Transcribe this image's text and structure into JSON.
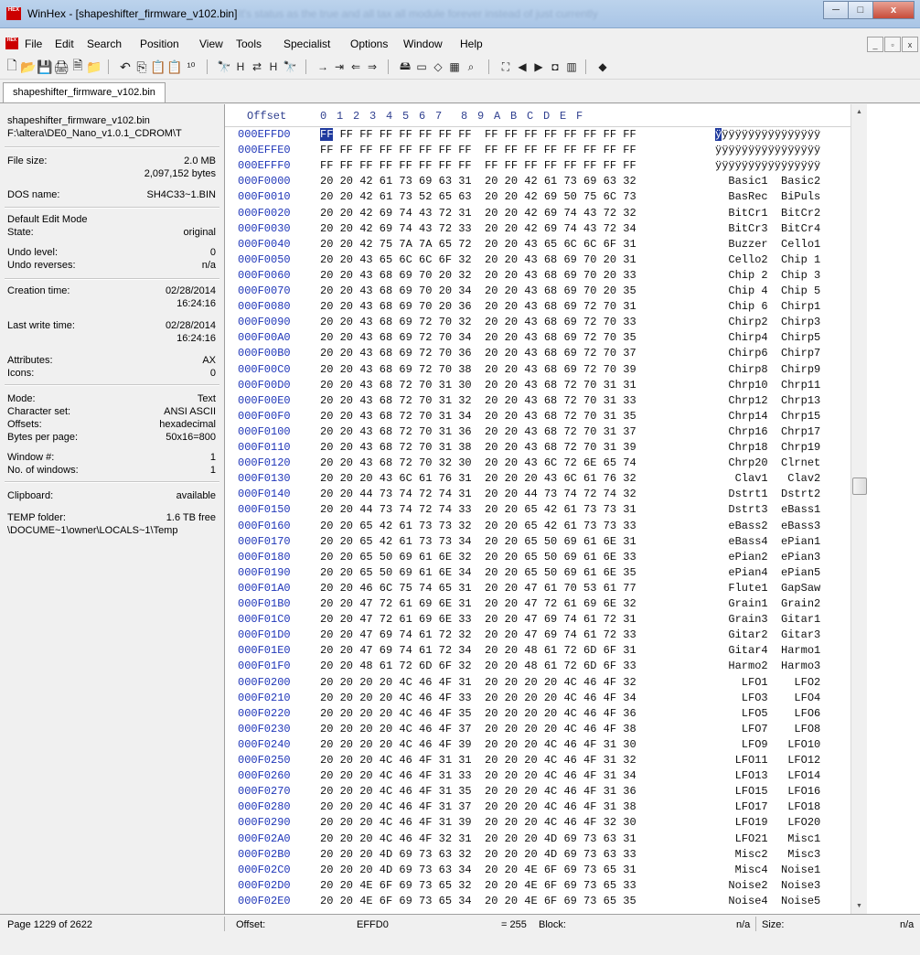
{
  "window": {
    "title": "WinHex - [shapeshifter_firmware_v102.bin]",
    "title_ghost": "It's status as the true and all tax all module forever instead of just currently",
    "minimize": "─",
    "maximize": "□",
    "close": "x"
  },
  "menu": {
    "app_icon": "HEX",
    "items": [
      "File",
      "Edit",
      "Search",
      "Position",
      "View",
      "Tools",
      "Specialist",
      "Options",
      "Window",
      "Help"
    ],
    "mdi_minimize": "_",
    "mdi_restore": "▫",
    "mdi_close": "x"
  },
  "toolbar": {
    "icons": [
      "new-file-icon",
      "open-folder-icon",
      "save-icon",
      "print-icon",
      "properties-icon",
      "open-disk-icon",
      "undo-icon",
      "copy-icon",
      "paste-icon",
      "paste-special-icon",
      "convert-icon",
      "find-text-icon",
      "find-hex-icon",
      "replace-text-icon",
      "replace-hex-icon",
      "find-again-icon",
      "goto-offset-icon",
      "goto-page-icon",
      "back-icon",
      "forward-icon",
      "open-disk-editor-icon",
      "ram-editor-icon",
      "data-interpreter-icon",
      "calculator-icon",
      "search-icon",
      "template-icon",
      "prev-icon",
      "next-icon",
      "camera-icon",
      "table-icon",
      "help-book-icon"
    ],
    "glyphs": [
      "🗋",
      "📂",
      "💾",
      "🖨",
      "🗎",
      "📁",
      "↶",
      "⎘",
      "📋",
      "📋",
      "¹⁰",
      "🔭",
      "H",
      "⇄",
      "H",
      "🔭",
      "→",
      "⇥",
      "⇐",
      "⇒",
      "🖴",
      "▭",
      "◇",
      "▦",
      "⌕",
      "⛶",
      "◀",
      "▶",
      "◘",
      "▥",
      "◆"
    ]
  },
  "tab": {
    "label": "shapeshifter_firmware_v102.bin"
  },
  "info_panel": {
    "file_name": "shapeshifter_firmware_v102.bin",
    "file_path": "F:\\altera\\DE0_Nano_v1.0.1_CDROM\\T",
    "file_size_label": "File size:",
    "file_size_mb": "2.0 MB",
    "file_size_bytes": "2,097,152 bytes",
    "dos_name_label": "DOS name:",
    "dos_name": "SH4C33~1.BIN",
    "edit_mode_label": "Default Edit Mode",
    "state_label": "State:",
    "state": "original",
    "undo_level_label": "Undo level:",
    "undo_level": "0",
    "undo_reverses_label": "Undo reverses:",
    "undo_reverses": "n/a",
    "creation_label": "Creation time:",
    "creation_date": "02/28/2014",
    "creation_time": "16:24:16",
    "lastwrite_label": "Last write time:",
    "lastwrite_date": "02/28/2014",
    "lastwrite_time": "16:24:16",
    "attributes_label": "Attributes:",
    "attributes": "AX",
    "icons_label": "Icons:",
    "icons": "0",
    "mode_label": "Mode:",
    "mode": "Text",
    "charset_label": "Character set:",
    "charset": "ANSI ASCII",
    "offsets_label": "Offsets:",
    "offsets": "hexadecimal",
    "bpp_label": "Bytes per page:",
    "bpp": "50x16=800",
    "window_label": "Window #:",
    "window_num": "1",
    "windows_label": "No. of windows:",
    "windows_count": "1",
    "clipboard_label": "Clipboard:",
    "clipboard": "available",
    "temp_label": "TEMP folder:",
    "temp_free": "1.6 TB free",
    "temp_path": "\\DOCUME~1\\owner\\LOCALS~1\\Temp"
  },
  "hex_view": {
    "offset_header": "Offset",
    "column_headers": [
      "0",
      "1",
      "2",
      "3",
      "4",
      "5",
      "6",
      "7",
      "8",
      "9",
      "A",
      "B",
      "C",
      "D",
      "E",
      "F"
    ],
    "rows": [
      {
        "offset": "000EFFD0",
        "hex": "FF FF FF FF FF FF FF FF  FF FF FF FF FF FF FF FF",
        "text": "ÿÿÿÿÿÿÿÿÿÿÿÿÿÿÿÿ"
      },
      {
        "offset": "000EFFE0",
        "hex": "FF FF FF FF FF FF FF FF  FF FF FF FF FF FF FF FF",
        "text": "ÿÿÿÿÿÿÿÿÿÿÿÿÿÿÿÿ"
      },
      {
        "offset": "000EFFF0",
        "hex": "FF FF FF FF FF FF FF FF  FF FF FF FF FF FF FF FF",
        "text": "ÿÿÿÿÿÿÿÿÿÿÿÿÿÿÿÿ"
      },
      {
        "offset": "000F0000",
        "hex": "20 20 42 61 73 69 63 31  20 20 42 61 73 69 63 32",
        "text": "  Basic1  Basic2"
      },
      {
        "offset": "000F0010",
        "hex": "20 20 42 61 73 52 65 63  20 20 42 69 50 75 6C 73",
        "text": "  BasRec  BiPuls"
      },
      {
        "offset": "000F0020",
        "hex": "20 20 42 69 74 43 72 31  20 20 42 69 74 43 72 32",
        "text": "  BitCr1  BitCr2"
      },
      {
        "offset": "000F0030",
        "hex": "20 20 42 69 74 43 72 33  20 20 42 69 74 43 72 34",
        "text": "  BitCr3  BitCr4"
      },
      {
        "offset": "000F0040",
        "hex": "20 20 42 75 7A 7A 65 72  20 20 43 65 6C 6C 6F 31",
        "text": "  Buzzer  Cello1"
      },
      {
        "offset": "000F0050",
        "hex": "20 20 43 65 6C 6C 6F 32  20 20 43 68 69 70 20 31",
        "text": "  Cello2  Chip 1"
      },
      {
        "offset": "000F0060",
        "hex": "20 20 43 68 69 70 20 32  20 20 43 68 69 70 20 33",
        "text": "  Chip 2  Chip 3"
      },
      {
        "offset": "000F0070",
        "hex": "20 20 43 68 69 70 20 34  20 20 43 68 69 70 20 35",
        "text": "  Chip 4  Chip 5"
      },
      {
        "offset": "000F0080",
        "hex": "20 20 43 68 69 70 20 36  20 20 43 68 69 72 70 31",
        "text": "  Chip 6  Chirp1"
      },
      {
        "offset": "000F0090",
        "hex": "20 20 43 68 69 72 70 32  20 20 43 68 69 72 70 33",
        "text": "  Chirp2  Chirp3"
      },
      {
        "offset": "000F00A0",
        "hex": "20 20 43 68 69 72 70 34  20 20 43 68 69 72 70 35",
        "text": "  Chirp4  Chirp5"
      },
      {
        "offset": "000F00B0",
        "hex": "20 20 43 68 69 72 70 36  20 20 43 68 69 72 70 37",
        "text": "  Chirp6  Chirp7"
      },
      {
        "offset": "000F00C0",
        "hex": "20 20 43 68 69 72 70 38  20 20 43 68 69 72 70 39",
        "text": "  Chirp8  Chirp9"
      },
      {
        "offset": "000F00D0",
        "hex": "20 20 43 68 72 70 31 30  20 20 43 68 72 70 31 31",
        "text": "  Chrp10  Chrp11"
      },
      {
        "offset": "000F00E0",
        "hex": "20 20 43 68 72 70 31 32  20 20 43 68 72 70 31 33",
        "text": "  Chrp12  Chrp13"
      },
      {
        "offset": "000F00F0",
        "hex": "20 20 43 68 72 70 31 34  20 20 43 68 72 70 31 35",
        "text": "  Chrp14  Chrp15"
      },
      {
        "offset": "000F0100",
        "hex": "20 20 43 68 72 70 31 36  20 20 43 68 72 70 31 37",
        "text": "  Chrp16  Chrp17"
      },
      {
        "offset": "000F0110",
        "hex": "20 20 43 68 72 70 31 38  20 20 43 68 72 70 31 39",
        "text": "  Chrp18  Chrp19"
      },
      {
        "offset": "000F0120",
        "hex": "20 20 43 68 72 70 32 30  20 20 43 6C 72 6E 65 74",
        "text": "  Chrp20  Clrnet"
      },
      {
        "offset": "000F0130",
        "hex": "20 20 20 43 6C 61 76 31  20 20 20 43 6C 61 76 32",
        "text": "   Clav1   Clav2"
      },
      {
        "offset": "000F0140",
        "hex": "20 20 44 73 74 72 74 31  20 20 44 73 74 72 74 32",
        "text": "  Dstrt1  Dstrt2"
      },
      {
        "offset": "000F0150",
        "hex": "20 20 44 73 74 72 74 33  20 20 65 42 61 73 73 31",
        "text": "  Dstrt3  eBass1"
      },
      {
        "offset": "000F0160",
        "hex": "20 20 65 42 61 73 73 32  20 20 65 42 61 73 73 33",
        "text": "  eBass2  eBass3"
      },
      {
        "offset": "000F0170",
        "hex": "20 20 65 42 61 73 73 34  20 20 65 50 69 61 6E 31",
        "text": "  eBass4  ePian1"
      },
      {
        "offset": "000F0180",
        "hex": "20 20 65 50 69 61 6E 32  20 20 65 50 69 61 6E 33",
        "text": "  ePian2  ePian3"
      },
      {
        "offset": "000F0190",
        "hex": "20 20 65 50 69 61 6E 34  20 20 65 50 69 61 6E 35",
        "text": "  ePian4  ePian5"
      },
      {
        "offset": "000F01A0",
        "hex": "20 20 46 6C 75 74 65 31  20 20 47 61 70 53 61 77",
        "text": "  Flute1  GapSaw"
      },
      {
        "offset": "000F01B0",
        "hex": "20 20 47 72 61 69 6E 31  20 20 47 72 61 69 6E 32",
        "text": "  Grain1  Grain2"
      },
      {
        "offset": "000F01C0",
        "hex": "20 20 47 72 61 69 6E 33  20 20 47 69 74 61 72 31",
        "text": "  Grain3  Gitar1"
      },
      {
        "offset": "000F01D0",
        "hex": "20 20 47 69 74 61 72 32  20 20 47 69 74 61 72 33",
        "text": "  Gitar2  Gitar3"
      },
      {
        "offset": "000F01E0",
        "hex": "20 20 47 69 74 61 72 34  20 20 48 61 72 6D 6F 31",
        "text": "  Gitar4  Harmo1"
      },
      {
        "offset": "000F01F0",
        "hex": "20 20 48 61 72 6D 6F 32  20 20 48 61 72 6D 6F 33",
        "text": "  Harmo2  Harmo3"
      },
      {
        "offset": "000F0200",
        "hex": "20 20 20 20 4C 46 4F 31  20 20 20 20 4C 46 4F 32",
        "text": "    LFO1    LFO2"
      },
      {
        "offset": "000F0210",
        "hex": "20 20 20 20 4C 46 4F 33  20 20 20 20 4C 46 4F 34",
        "text": "    LFO3    LFO4"
      },
      {
        "offset": "000F0220",
        "hex": "20 20 20 20 4C 46 4F 35  20 20 20 20 4C 46 4F 36",
        "text": "    LFO5    LFO6"
      },
      {
        "offset": "000F0230",
        "hex": "20 20 20 20 4C 46 4F 37  20 20 20 20 4C 46 4F 38",
        "text": "    LFO7    LFO8"
      },
      {
        "offset": "000F0240",
        "hex": "20 20 20 20 4C 46 4F 39  20 20 20 4C 46 4F 31 30",
        "text": "    LFO9   LFO10"
      },
      {
        "offset": "000F0250",
        "hex": "20 20 20 4C 46 4F 31 31  20 20 20 4C 46 4F 31 32",
        "text": "   LFO11   LFO12"
      },
      {
        "offset": "000F0260",
        "hex": "20 20 20 4C 46 4F 31 33  20 20 20 4C 46 4F 31 34",
        "text": "   LFO13   LFO14"
      },
      {
        "offset": "000F0270",
        "hex": "20 20 20 4C 46 4F 31 35  20 20 20 4C 46 4F 31 36",
        "text": "   LFO15   LFO16"
      },
      {
        "offset": "000F0280",
        "hex": "20 20 20 4C 46 4F 31 37  20 20 20 4C 46 4F 31 38",
        "text": "   LFO17   LFO18"
      },
      {
        "offset": "000F0290",
        "hex": "20 20 20 4C 46 4F 31 39  20 20 20 4C 46 4F 32 30",
        "text": "   LFO19   LFO20"
      },
      {
        "offset": "000F02A0",
        "hex": "20 20 20 4C 46 4F 32 31  20 20 20 4D 69 73 63 31",
        "text": "   LFO21   Misc1"
      },
      {
        "offset": "000F02B0",
        "hex": "20 20 20 4D 69 73 63 32  20 20 20 4D 69 73 63 33",
        "text": "   Misc2   Misc3"
      },
      {
        "offset": "000F02C0",
        "hex": "20 20 20 4D 69 73 63 34  20 20 4E 6F 69 73 65 31",
        "text": "   Misc4  Noise1"
      },
      {
        "offset": "000F02D0",
        "hex": "20 20 4E 6F 69 73 65 32  20 20 4E 6F 69 73 65 33",
        "text": "  Noise2  Noise3"
      },
      {
        "offset": "000F02E0",
        "hex": "20 20 4E 6F 69 73 65 34  20 20 4E 6F 69 73 65 35",
        "text": "  Noise4  Noise5"
      }
    ]
  },
  "scrollbar": {
    "up": "▲",
    "down": "▼",
    "position_fraction": 0.47
  },
  "status": {
    "page": "Page 1229 of 2622",
    "offset_label": "Offset:",
    "offset_value": "EFFD0",
    "value": "= 255",
    "block_label": "Block:",
    "block_value": "n/a",
    "size_label": "Size:",
    "size_value": "n/a"
  }
}
